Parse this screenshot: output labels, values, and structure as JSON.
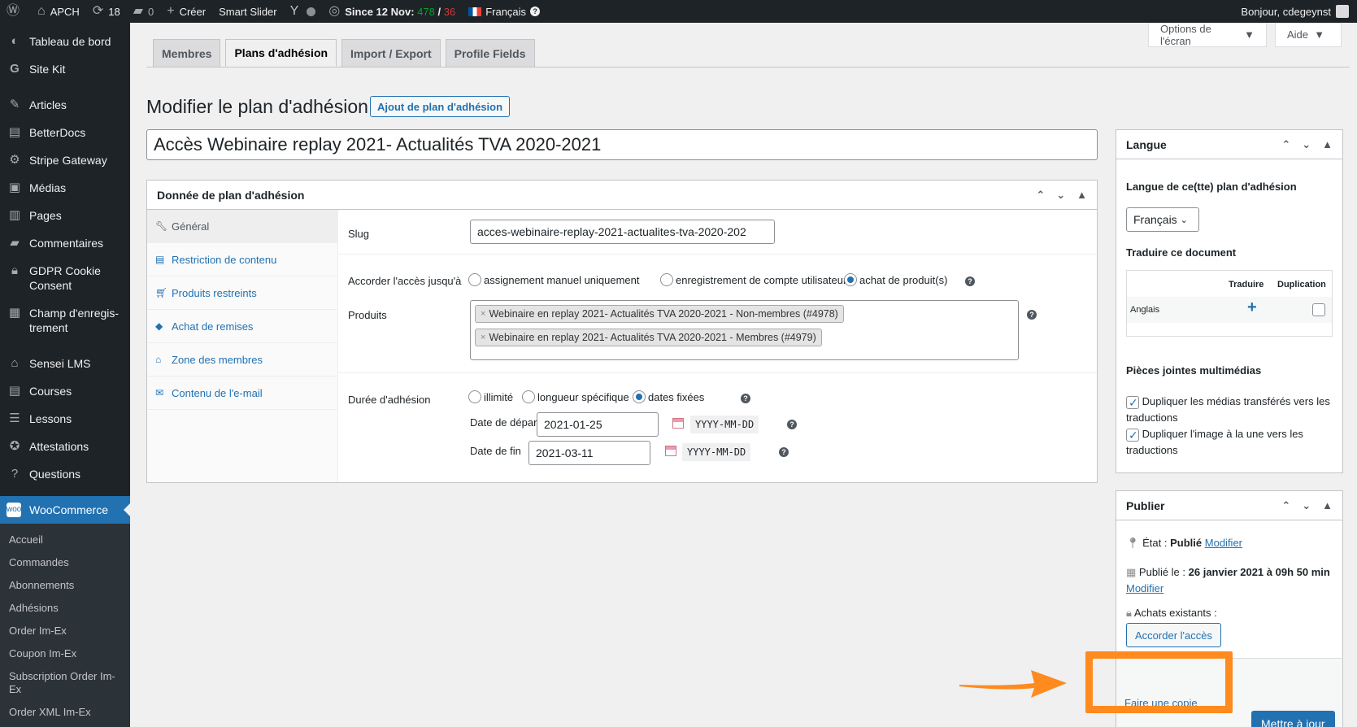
{
  "adminbar": {
    "site_name": "APCH",
    "updates": "18",
    "comments": "0",
    "create": "Créer",
    "smart_slider": "Smart Slider",
    "since_label": "Since 12 Nov:",
    "since_green": "478",
    "since_sep": "/",
    "since_red": "36",
    "language": "Français",
    "greeting": "Bonjour, cdegeynst"
  },
  "sidebar": {
    "items": [
      {
        "label": "Tableau de bord",
        "icon": "dashboard-icon"
      },
      {
        "label": "Site Kit",
        "icon": "google-g-icon"
      },
      {
        "label": "Articles",
        "icon": "pin-icon"
      },
      {
        "label": "BetterDocs",
        "icon": "docs-icon"
      },
      {
        "label": "Stripe Gateway",
        "icon": "gear-icon"
      },
      {
        "label": "Médias",
        "icon": "media-icon"
      },
      {
        "label": "Pages",
        "icon": "pages-icon"
      },
      {
        "label": "Commentaires",
        "icon": "comment-icon"
      },
      {
        "label": "GDPR Cookie Consent",
        "icon": "lock-icon"
      },
      {
        "label": "Champ d'enregis-trement",
        "icon": "form-icon"
      },
      {
        "label": "Sensei LMS",
        "icon": "graduation-icon"
      },
      {
        "label": "Courses",
        "icon": "book-icon"
      },
      {
        "label": "Lessons",
        "icon": "list-icon"
      },
      {
        "label": "Attestations",
        "icon": "award-icon"
      },
      {
        "label": "Questions",
        "icon": "question-icon"
      },
      {
        "label": "WooCommerce",
        "icon": "woo-icon"
      }
    ],
    "submenu": [
      "Accueil",
      "Commandes",
      "Abonnements",
      "Adhésions",
      "Order Im-Ex",
      "Coupon Im-Ex",
      "Subscription Order Im-Ex",
      "Order XML Im-Ex"
    ]
  },
  "screen_options": {
    "options": "Options de l'écran",
    "help": "Aide"
  },
  "tabs": [
    "Membres",
    "Plans d'adhésion",
    "Import / Export",
    "Profile Fields"
  ],
  "page": {
    "title": "Modifier le plan d'adhésion",
    "add_button": "Ajout de plan d'adhésion",
    "post_title": "Accès Webinaire replay 2021- Actualités TVA 2020-2021"
  },
  "data_box": {
    "title": "Donnée de plan d'adhésion",
    "tabs": [
      {
        "label": "Général",
        "icon": "wrench-icon"
      },
      {
        "label": "Restriction de contenu",
        "icon": "doc-lines-icon"
      },
      {
        "label": "Produits restreints",
        "icon": "cart-icon"
      },
      {
        "label": "Achat de remises",
        "icon": "tag-icon"
      },
      {
        "label": "Zone des membres",
        "icon": "home-icon"
      },
      {
        "label": "Contenu de l'e-mail",
        "icon": "mail-icon"
      }
    ],
    "slug_label": "Slug",
    "slug_value": "acces-webinaire-replay-2021-actualites-tva-2020-202",
    "access_label": "Accorder l'accès jusqu'à",
    "access_options": [
      "assignement manuel uniquement",
      "enregistrement de compte utilisateur",
      "achat de produit(s)"
    ],
    "products_label": "Produits",
    "products": [
      "Webinaire en replay 2021- Actualités TVA 2020-2021 - Non-membres (#4978)",
      "Webinaire en replay 2021- Actualités TVA 2020-2021 - Membres (#4979)"
    ],
    "duration_label": "Durée d'adhésion",
    "duration_options": [
      "illimité",
      "longueur spécifique",
      "dates fixées"
    ],
    "start_label": "Date de départ",
    "start_value": "2021-01-25",
    "end_label": "Date de fin",
    "end_value": "2021-03-11",
    "date_format": "YYYY-MM-DD"
  },
  "langue_box": {
    "title": "Langue",
    "lang_label": "Langue de ce(tte) plan d'adhésion",
    "lang_value": "Français",
    "translate_label": "Traduire ce document",
    "col_translate": "Traduire",
    "col_duplicate": "Duplication",
    "row_lang": "Anglais",
    "media_title": "Pièces jointes multimédias",
    "dup_media": "Dupliquer les médias transférés vers les traductions",
    "dup_image": "Dupliquer l'image à la une vers les traductions"
  },
  "publish_box": {
    "title": "Publier",
    "status_label": "État :",
    "status_value": "Publié",
    "modify": "Modifier",
    "published_label": "Publié le :",
    "published_value": "26 janvier 2021 à 09h 50 min",
    "purchases_label": "Achats existants :",
    "grant_access": "Accorder l'accès",
    "copy": "Faire une copie",
    "update": "Mettre à jour"
  },
  "colors": {
    "accent": "#2271b1",
    "highlight": "#ff8a1e",
    "adminbar": "#1d2327"
  }
}
